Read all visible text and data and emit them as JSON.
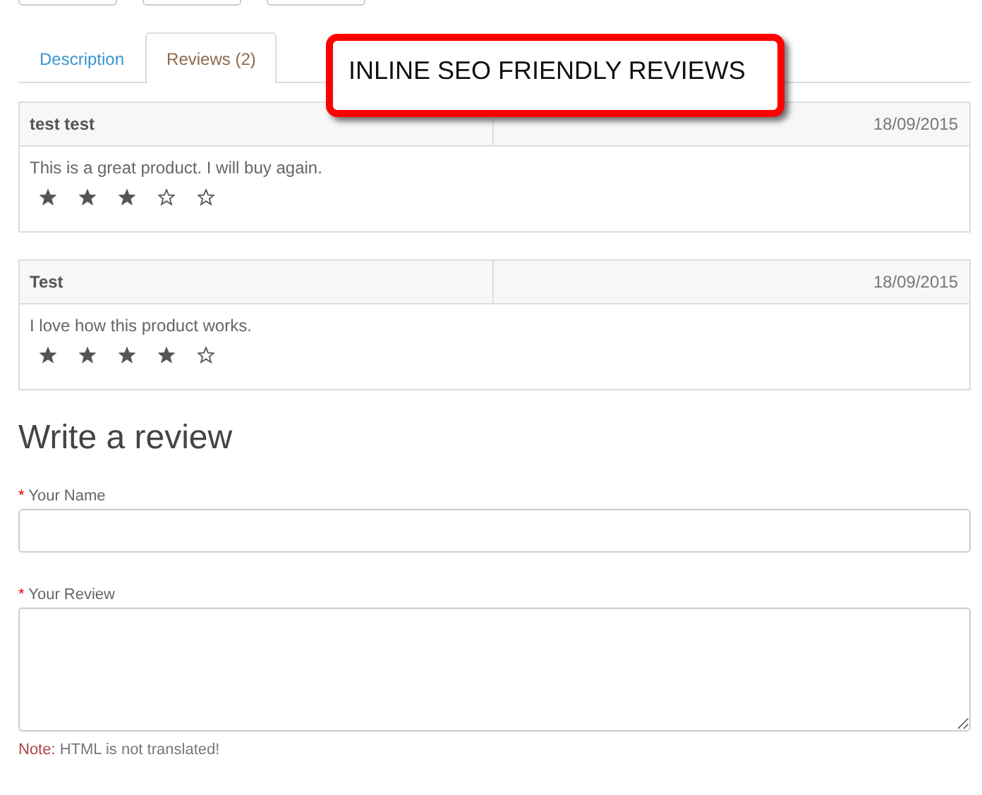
{
  "top_buttons": [
    {
      "kind": "blank"
    },
    {
      "kind": "blank"
    },
    {
      "kind": "blank"
    }
  ],
  "tabs": [
    {
      "label": "Description",
      "selected": false
    },
    {
      "label": "Reviews (2)",
      "selected": true
    }
  ],
  "callout": {
    "text": "INLINE SEO FRIENDLY REVIEWS"
  },
  "reviews": [
    {
      "author": "test test",
      "date": "18/09/2015",
      "text": "This is a great product. I will buy again.",
      "stars": 3
    },
    {
      "author": "Test",
      "date": "18/09/2015",
      "text": "I love how this product works.",
      "stars": 4
    }
  ],
  "form": {
    "heading": "Write a review",
    "fields": [
      {
        "kind": "input",
        "label": "Your Name",
        "required_mark": "*"
      },
      {
        "kind": "textarea",
        "label": "Your Review",
        "required_mark": "*"
      }
    ],
    "note": {
      "label": "Note:",
      "text": "HTML is not translated!"
    }
  }
}
